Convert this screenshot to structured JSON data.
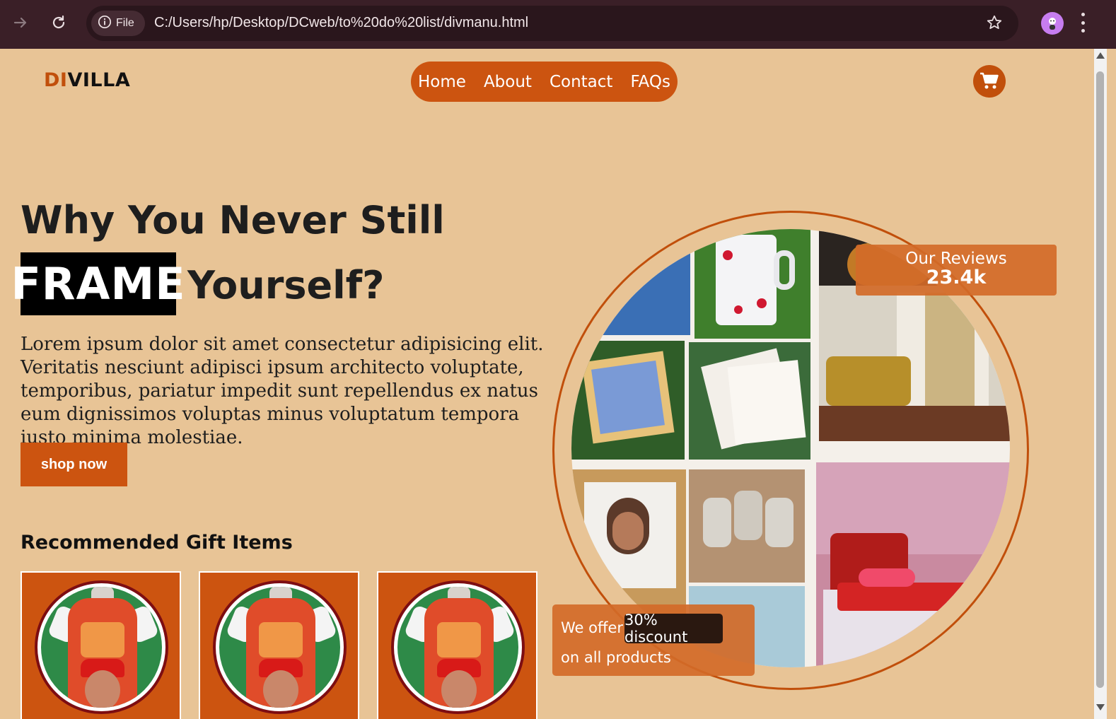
{
  "browser": {
    "url": "C:/Users/hp/Desktop/DCweb/to%20do%20list/divmanu.html",
    "file_chip": "File",
    "icons": [
      "forward-icon",
      "reload-icon",
      "info-icon",
      "star-icon",
      "profile-icon",
      "more-icon"
    ]
  },
  "header": {
    "logo_a": "DI",
    "logo_b": "VILLA",
    "nav": [
      "Home",
      "About",
      "Contact",
      "FAQs"
    ],
    "cart_icon": "cart-icon"
  },
  "hero": {
    "line1": "Why You Never Still",
    "highlight": "FRAME",
    "line2": "Yourself?",
    "body": "Lorem ipsum dolor sit amet consectetur adipisicing elit. Veritatis nesciunt adipisci ipsum architecto voluptate, temporibus, pariatur impedit sunt repellendus ex natus eum dignissimos voluptas minus voluptatum tempora iusto minima molestiae.",
    "button": "shop now"
  },
  "recommended": {
    "title": "Recommended Gift Items",
    "items": [
      {},
      {},
      {}
    ]
  },
  "reviews": {
    "label": "Our Reviews",
    "count": "23.4k"
  },
  "offer": {
    "prefix": "We offer",
    "highlight": "30% discount",
    "suffix": "on all products"
  },
  "colors": {
    "background": "#e8c496",
    "accent": "#cc5410",
    "dark": "#1e1e1e"
  }
}
